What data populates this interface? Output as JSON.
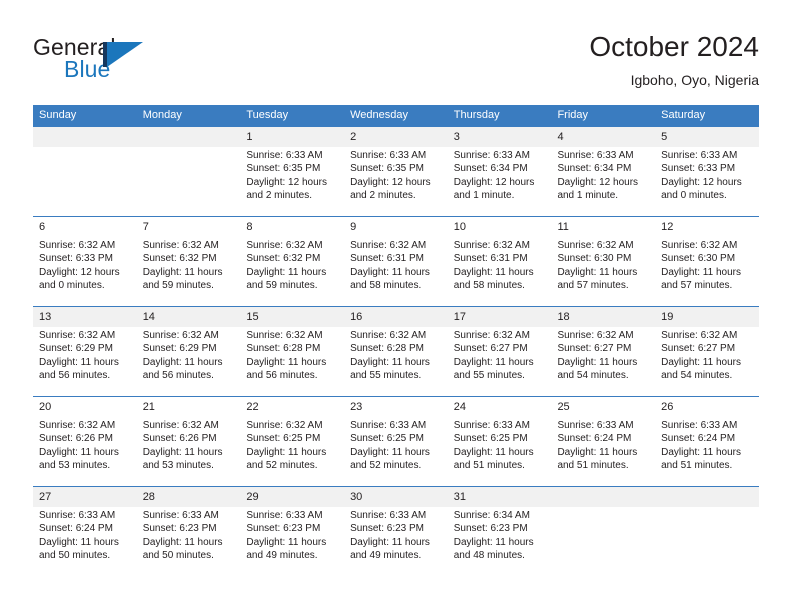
{
  "brand": {
    "name_part1": "General",
    "name_part2": "Blue",
    "logo_icon": "triangle-flag-icon",
    "color_dark": "#15375E",
    "color_blue": "#1B76BC"
  },
  "header": {
    "title": "October 2024",
    "subtitle": "Igboho, Oyo, Nigeria"
  },
  "theme": {
    "header_row_bg": "#3A7CC0",
    "header_row_text": "#FFFFFF",
    "daynum_band_bg": "#F1F1F1",
    "grid_line": "#3A7CC0",
    "body_text": "#231F20"
  },
  "weekdays": [
    "Sunday",
    "Monday",
    "Tuesday",
    "Wednesday",
    "Thursday",
    "Friday",
    "Saturday"
  ],
  "weeks": [
    [
      {
        "day": "",
        "lines": []
      },
      {
        "day": "",
        "lines": []
      },
      {
        "day": "1",
        "lines": [
          "Sunrise: 6:33 AM",
          "Sunset: 6:35 PM",
          "Daylight: 12 hours",
          "and 2 minutes."
        ]
      },
      {
        "day": "2",
        "lines": [
          "Sunrise: 6:33 AM",
          "Sunset: 6:35 PM",
          "Daylight: 12 hours",
          "and 2 minutes."
        ]
      },
      {
        "day": "3",
        "lines": [
          "Sunrise: 6:33 AM",
          "Sunset: 6:34 PM",
          "Daylight: 12 hours",
          "and 1 minute."
        ]
      },
      {
        "day": "4",
        "lines": [
          "Sunrise: 6:33 AM",
          "Sunset: 6:34 PM",
          "Daylight: 12 hours",
          "and 1 minute."
        ]
      },
      {
        "day": "5",
        "lines": [
          "Sunrise: 6:33 AM",
          "Sunset: 6:33 PM",
          "Daylight: 12 hours",
          "and 0 minutes."
        ]
      }
    ],
    [
      {
        "day": "6",
        "lines": [
          "Sunrise: 6:32 AM",
          "Sunset: 6:33 PM",
          "Daylight: 12 hours",
          "and 0 minutes."
        ]
      },
      {
        "day": "7",
        "lines": [
          "Sunrise: 6:32 AM",
          "Sunset: 6:32 PM",
          "Daylight: 11 hours",
          "and 59 minutes."
        ]
      },
      {
        "day": "8",
        "lines": [
          "Sunrise: 6:32 AM",
          "Sunset: 6:32 PM",
          "Daylight: 11 hours",
          "and 59 minutes."
        ]
      },
      {
        "day": "9",
        "lines": [
          "Sunrise: 6:32 AM",
          "Sunset: 6:31 PM",
          "Daylight: 11 hours",
          "and 58 minutes."
        ]
      },
      {
        "day": "10",
        "lines": [
          "Sunrise: 6:32 AM",
          "Sunset: 6:31 PM",
          "Daylight: 11 hours",
          "and 58 minutes."
        ]
      },
      {
        "day": "11",
        "lines": [
          "Sunrise: 6:32 AM",
          "Sunset: 6:30 PM",
          "Daylight: 11 hours",
          "and 57 minutes."
        ]
      },
      {
        "day": "12",
        "lines": [
          "Sunrise: 6:32 AM",
          "Sunset: 6:30 PM",
          "Daylight: 11 hours",
          "and 57 minutes."
        ]
      }
    ],
    [
      {
        "day": "13",
        "lines": [
          "Sunrise: 6:32 AM",
          "Sunset: 6:29 PM",
          "Daylight: 11 hours",
          "and 56 minutes."
        ]
      },
      {
        "day": "14",
        "lines": [
          "Sunrise: 6:32 AM",
          "Sunset: 6:29 PM",
          "Daylight: 11 hours",
          "and 56 minutes."
        ]
      },
      {
        "day": "15",
        "lines": [
          "Sunrise: 6:32 AM",
          "Sunset: 6:28 PM",
          "Daylight: 11 hours",
          "and 56 minutes."
        ]
      },
      {
        "day": "16",
        "lines": [
          "Sunrise: 6:32 AM",
          "Sunset: 6:28 PM",
          "Daylight: 11 hours",
          "and 55 minutes."
        ]
      },
      {
        "day": "17",
        "lines": [
          "Sunrise: 6:32 AM",
          "Sunset: 6:27 PM",
          "Daylight: 11 hours",
          "and 55 minutes."
        ]
      },
      {
        "day": "18",
        "lines": [
          "Sunrise: 6:32 AM",
          "Sunset: 6:27 PM",
          "Daylight: 11 hours",
          "and 54 minutes."
        ]
      },
      {
        "day": "19",
        "lines": [
          "Sunrise: 6:32 AM",
          "Sunset: 6:27 PM",
          "Daylight: 11 hours",
          "and 54 minutes."
        ]
      }
    ],
    [
      {
        "day": "20",
        "lines": [
          "Sunrise: 6:32 AM",
          "Sunset: 6:26 PM",
          "Daylight: 11 hours",
          "and 53 minutes."
        ]
      },
      {
        "day": "21",
        "lines": [
          "Sunrise: 6:32 AM",
          "Sunset: 6:26 PM",
          "Daylight: 11 hours",
          "and 53 minutes."
        ]
      },
      {
        "day": "22",
        "lines": [
          "Sunrise: 6:32 AM",
          "Sunset: 6:25 PM",
          "Daylight: 11 hours",
          "and 52 minutes."
        ]
      },
      {
        "day": "23",
        "lines": [
          "Sunrise: 6:33 AM",
          "Sunset: 6:25 PM",
          "Daylight: 11 hours",
          "and 52 minutes."
        ]
      },
      {
        "day": "24",
        "lines": [
          "Sunrise: 6:33 AM",
          "Sunset: 6:25 PM",
          "Daylight: 11 hours",
          "and 51 minutes."
        ]
      },
      {
        "day": "25",
        "lines": [
          "Sunrise: 6:33 AM",
          "Sunset: 6:24 PM",
          "Daylight: 11 hours",
          "and 51 minutes."
        ]
      },
      {
        "day": "26",
        "lines": [
          "Sunrise: 6:33 AM",
          "Sunset: 6:24 PM",
          "Daylight: 11 hours",
          "and 51 minutes."
        ]
      }
    ],
    [
      {
        "day": "27",
        "lines": [
          "Sunrise: 6:33 AM",
          "Sunset: 6:24 PM",
          "Daylight: 11 hours",
          "and 50 minutes."
        ]
      },
      {
        "day": "28",
        "lines": [
          "Sunrise: 6:33 AM",
          "Sunset: 6:23 PM",
          "Daylight: 11 hours",
          "and 50 minutes."
        ]
      },
      {
        "day": "29",
        "lines": [
          "Sunrise: 6:33 AM",
          "Sunset: 6:23 PM",
          "Daylight: 11 hours",
          "and 49 minutes."
        ]
      },
      {
        "day": "30",
        "lines": [
          "Sunrise: 6:33 AM",
          "Sunset: 6:23 PM",
          "Daylight: 11 hours",
          "and 49 minutes."
        ]
      },
      {
        "day": "31",
        "lines": [
          "Sunrise: 6:34 AM",
          "Sunset: 6:23 PM",
          "Daylight: 11 hours",
          "and 48 minutes."
        ]
      },
      {
        "day": "",
        "lines": []
      },
      {
        "day": "",
        "lines": []
      }
    ]
  ]
}
